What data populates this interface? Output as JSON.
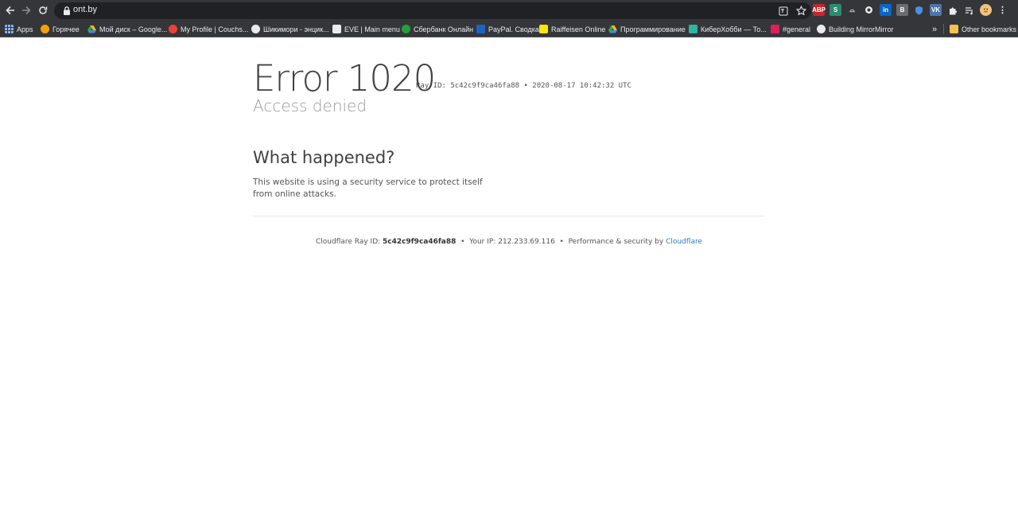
{
  "browser": {
    "url": "ont.by",
    "bookmarks": [
      {
        "label": "Apps",
        "color": "#e8eaed"
      },
      {
        "label": "Горячее",
        "color": "#f4a100"
      },
      {
        "label": "Мой диск – Google...",
        "color": "#34a853"
      },
      {
        "label": "My Profile | Couchs...",
        "color": "#ea4335"
      },
      {
        "label": "Шикимори - энцик...",
        "color": "#e8eaed"
      },
      {
        "label": "EVE | Main menu",
        "color": "#4a90d9"
      },
      {
        "label": "Сбербанк Онлайн",
        "color": "#21a038"
      },
      {
        "label": "PayPal. Сводка",
        "color": "#1e63c4"
      },
      {
        "label": "Raiffeisen Online",
        "color": "#fee600"
      },
      {
        "label": "Программирование",
        "color": "#34a853"
      },
      {
        "label": "КиберХобби — То...",
        "color": "#2bb5a0"
      },
      {
        "label": "#general",
        "color": "#e01e5a"
      },
      {
        "label": "Building MirrorMirror",
        "color": "#e8eaed"
      }
    ],
    "overflow_label": "»",
    "other_bookmarks": "Other bookmarks",
    "extensions": [
      "ABP",
      "S",
      "",
      "",
      "in",
      "B",
      "",
      "VK",
      "",
      "",
      ""
    ]
  },
  "page": {
    "error_title": "Error 1020",
    "ray_line": "Ray ID: 5c42c9f9ca46fa88 • 2020-08-17 10:42:32 UTC",
    "subtitle": "Access denied",
    "section_title": "What happened?",
    "description": "This website is using a security service to protect itself from online attacks.",
    "footer": {
      "ray_label": "Cloudflare Ray ID:",
      "ray_id": "5c42c9f9ca46fa88",
      "sep1": "•",
      "ip_text": "Your IP: 212.233.69.116",
      "sep2": "•",
      "perf_text": "Performance & security by",
      "link": "Cloudflare"
    }
  }
}
